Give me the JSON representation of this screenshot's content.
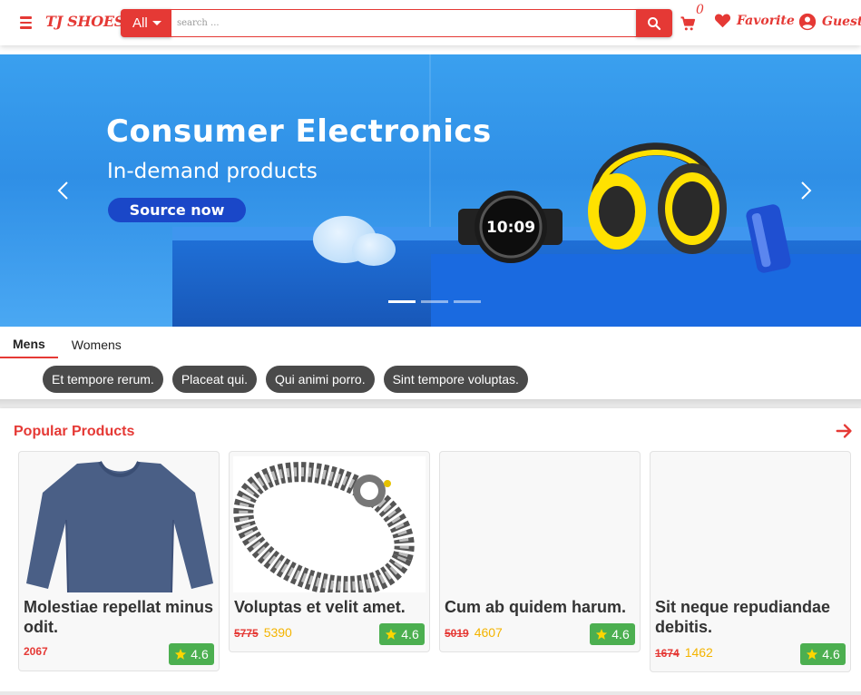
{
  "brand": {
    "logo": "TJ SHOES",
    "accent": "#e53935"
  },
  "search": {
    "category": "All",
    "placeholder": "search ..."
  },
  "header": {
    "cart_count": "0",
    "favorite_label": "Favorite",
    "guest_label": "Guest"
  },
  "banner": {
    "title": "Consumer Electronics",
    "subtitle": "In-demand products",
    "cta": "Source now",
    "watch_time": "10:09",
    "slides": 3,
    "active_slide": 0
  },
  "tabs": [
    {
      "label": "Mens",
      "active": true
    },
    {
      "label": "Womens",
      "active": false
    }
  ],
  "chips": [
    "Et tempore rerum.",
    "Placeat qui.",
    "Qui animi porro.",
    "Sint tempore voluptas."
  ],
  "section": {
    "title": "Popular Products"
  },
  "products": [
    {
      "name": "Molestiae repellat minus odit.",
      "old_price": "",
      "price": "2067",
      "rating": "4.6",
      "image": "sweater"
    },
    {
      "name": "Voluptas et velit amet.",
      "old_price": "5775",
      "price": "5390",
      "rating": "4.6",
      "image": "bracelet"
    },
    {
      "name": "Cum ab quidem harum.",
      "old_price": "5019",
      "price": "4607",
      "rating": "4.6",
      "image": "none"
    },
    {
      "name": "Sit neque repudiandae debitis.",
      "old_price": "1674",
      "price": "1462",
      "rating": "4.6",
      "image": "none"
    }
  ]
}
